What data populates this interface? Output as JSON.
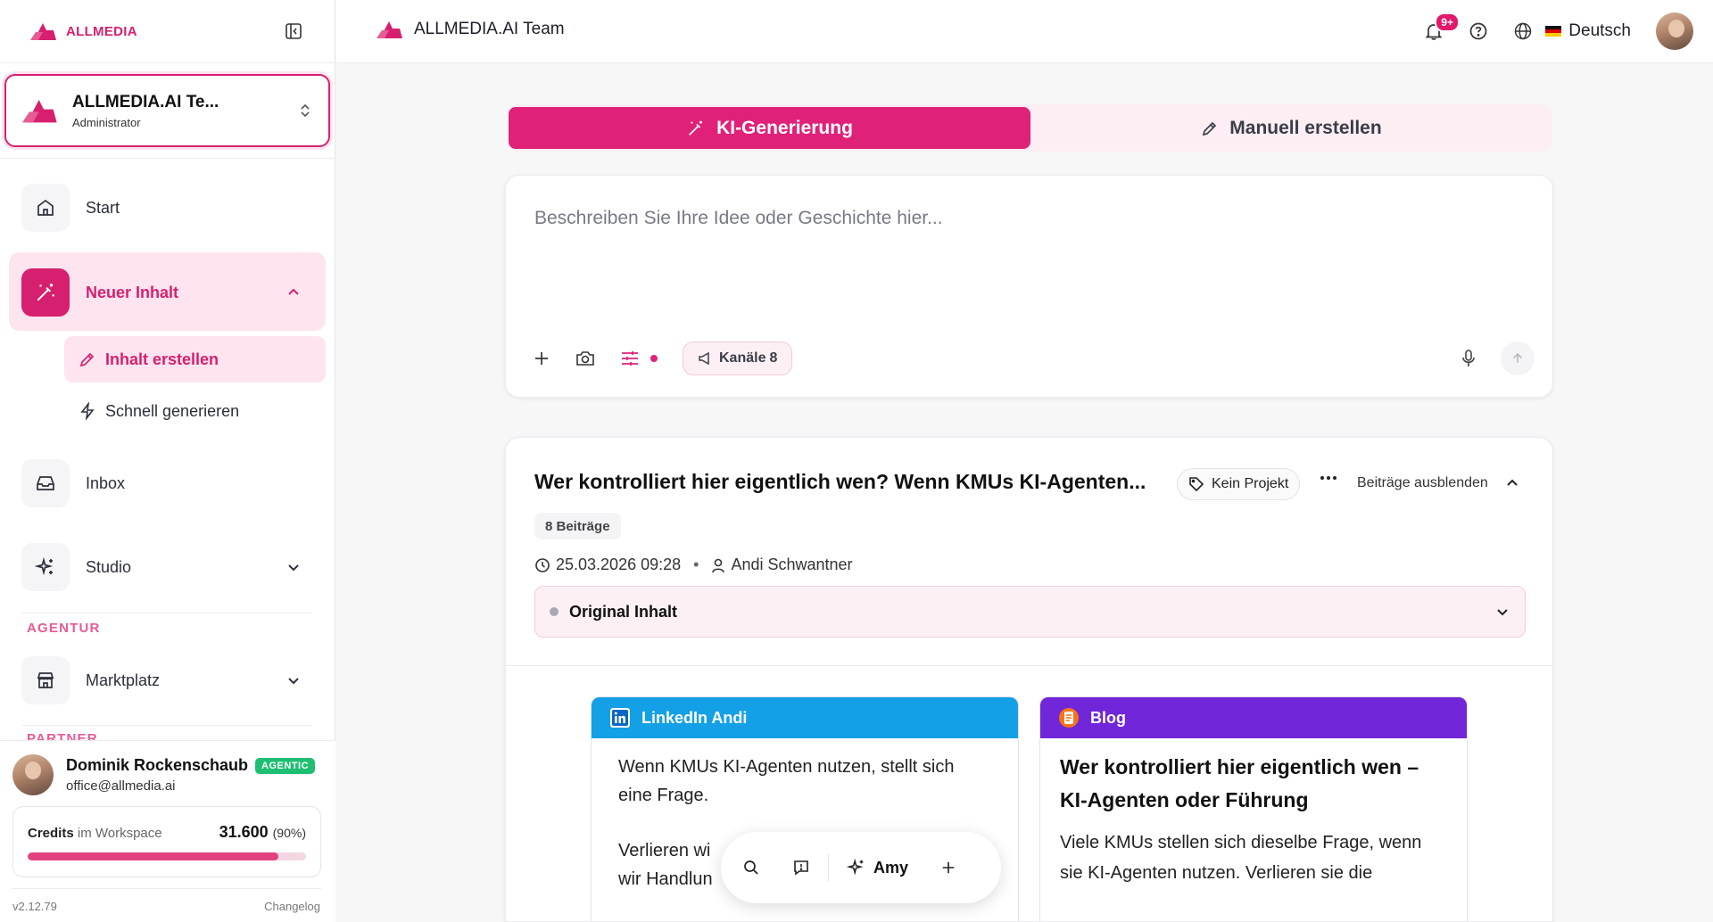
{
  "colors": {
    "accent": "#e0217a",
    "accent_light": "#fde4ef",
    "linkedin": "#14a0e6",
    "blog": "#7126d9",
    "badge_green": "#1fbf73"
  },
  "sidebar": {
    "brand": "ALLMEDIA",
    "team": {
      "name": "ALLMEDIA.AI Te...",
      "role": "Administrator"
    },
    "nav": {
      "start": "Start",
      "new_content": "Neuer Inhalt",
      "create_content": "Inhalt erstellen",
      "quick_generate": "Schnell generieren",
      "inbox": "Inbox",
      "studio": "Studio",
      "section_agency": "AGENTUR",
      "marketplace": "Marktplatz",
      "section_partner": "PARTNER"
    },
    "user": {
      "name": "Dominik Rockenschaub",
      "badge": "AGENTIC",
      "email": "office@allmedia.ai"
    },
    "credits": {
      "label": "Credits",
      "scope": "im Workspace",
      "value": "31.600",
      "percent_text": "(90%)",
      "fill_fraction": 0.9
    },
    "version": "v2.12.79",
    "changelog": "Changelog"
  },
  "header": {
    "team": "ALLMEDIA.AI Team",
    "notifications": "9+",
    "language": "Deutsch"
  },
  "main": {
    "tabs": [
      {
        "label": "KI-Generierung",
        "icon": "magic-wand-icon",
        "active": true
      },
      {
        "label": "Manuell erstellen",
        "icon": "pencil-icon",
        "active": false
      }
    ],
    "composer": {
      "placeholder": "Beschreiben Sie Ihre Idee oder Geschichte hier...",
      "channels_label": "Kanäle",
      "channels_count": "8"
    },
    "post_group": {
      "title": "Wer kontrolliert hier eigentlich wen? Wenn KMUs KI-Agenten...",
      "project": "Kein Projekt",
      "hide_label": "Beiträge ausblenden",
      "count": "8 Beiträge",
      "date": "25.03.2026 09:28",
      "author": "Andi Schwantner",
      "original": "Original Inhalt"
    },
    "posts": {
      "linkedin": {
        "channel": "LinkedIn Andi",
        "para1": "Wenn KMUs KI-Agenten nutzen, stellt sich eine Frage.",
        "para2_line1": "Verlieren wi",
        "para2_line2": "wir Handlun"
      },
      "blog": {
        "channel": "Blog",
        "title": "Wer kontrolliert hier eigentlich wen – KI-Agenten oder Führung",
        "text": "Viele KMUs stellen sich dieselbe Frage, wenn sie KI-Agenten nutzen. Verlieren sie die"
      }
    },
    "floating_bar": {
      "amy": "Amy"
    }
  }
}
